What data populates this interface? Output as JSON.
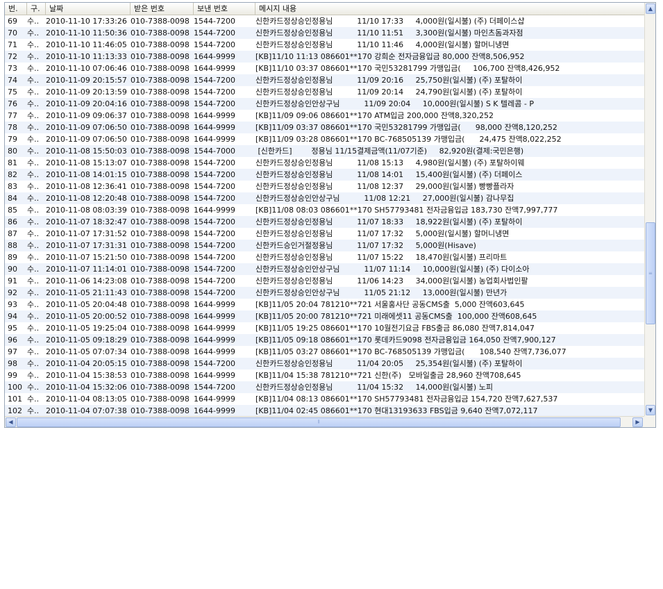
{
  "columns": [
    "번.",
    "구.",
    "날짜",
    "받은 번호",
    "보낸 번호",
    "메시지 내용"
  ],
  "rows": [
    {
      "no": "69",
      "type": "수..",
      "date": "2010-11-10 17:33:26",
      "recv": "010-7388-0098",
      "send": "1544-7200",
      "msg": "신한카드정상승인정용님          11/10 17:33     4,000원(일시불) (주) 더페이스샵"
    },
    {
      "no": "70",
      "type": "수..",
      "date": "2010-11-10 11:50:36",
      "recv": "010-7388-0098",
      "send": "1544-7200",
      "msg": "신한카드정상승인정용님          11/10 11:51     3,300원(일시불) 마인츠돔과자점"
    },
    {
      "no": "71",
      "type": "수..",
      "date": "2010-11-10 11:46:05",
      "recv": "010-7388-0098",
      "send": "1544-7200",
      "msg": "신한카드정상승인정용님          11/10 11:46     4,000원(일시불) 할머니냉면"
    },
    {
      "no": "72",
      "type": "수..",
      "date": "2010-11-10 11:13:33",
      "recv": "010-7388-0098",
      "send": "1644-9999",
      "msg": "[KB]11/10 11:13 086601**170 강희순 전자금융입금 80,000 잔액8,506,952"
    },
    {
      "no": "73",
      "type": "수..",
      "date": "2010-11-10 07:06:46",
      "recv": "010-7388-0098",
      "send": "1644-9999",
      "msg": "[KB]11/10 03:37 086601**170 국민53281799 가맹입금(     106,700 잔액8,426,952"
    },
    {
      "no": "74",
      "type": "수..",
      "date": "2010-11-09 20:15:57",
      "recv": "010-7388-0098",
      "send": "1544-7200",
      "msg": "신한카드정상승인정용님          11/09 20:16     25,750원(일시불) (주) 포탈하이"
    },
    {
      "no": "75",
      "type": "수..",
      "date": "2010-11-09 20:13:59",
      "recv": "010-7388-0098",
      "send": "1544-7200",
      "msg": "신한카드정상승인정용님          11/09 20:14     24,790원(일시불) (주) 포탈하이"
    },
    {
      "no": "76",
      "type": "수..",
      "date": "2010-11-09 20:04:16",
      "recv": "010-7388-0098",
      "send": "1544-7200",
      "msg": "신한카드정상승인안상구님          11/09 20:04     10,000원(일시불) S K 텔레콤 - P"
    },
    {
      "no": "77",
      "type": "수..",
      "date": "2010-11-09 09:06:37",
      "recv": "010-7388-0098",
      "send": "1644-9999",
      "msg": "[KB]11/09 09:06 086601**170 ATM입금 200,000 잔액8,320,252"
    },
    {
      "no": "78",
      "type": "수..",
      "date": "2010-11-09 07:06:50",
      "recv": "010-7388-0098",
      "send": "1644-9999",
      "msg": "[KB]11/09 03:37 086601**170 국민53281799 가맹입금(      98,000 잔액8,120,252"
    },
    {
      "no": "79",
      "type": "수..",
      "date": "2010-11-09 07:06:50",
      "recv": "010-7388-0098",
      "send": "1644-9999",
      "msg": "[KB]11/09 03:28 086601**170 BC-768505139 가맹입금(      24,475 잔액8,022,252"
    },
    {
      "no": "80",
      "type": "수..",
      "date": "2010-11-08 15:50:03",
      "recv": "010-7388-0098",
      "send": "1544-7000",
      "msg": " [신한카드]        정용님 11/15결제금액(11/07기준)     82,920원(결제:국민은행)"
    },
    {
      "no": "81",
      "type": "수..",
      "date": "2010-11-08 15:13:07",
      "recv": "010-7388-0098",
      "send": "1544-7200",
      "msg": "신한카드정상승인정용님          11/08 15:13     4,980원(일시불) (주) 포탈하이웨"
    },
    {
      "no": "82",
      "type": "수..",
      "date": "2010-11-08 14:01:15",
      "recv": "010-7388-0098",
      "send": "1544-7200",
      "msg": "신한카드정상승인정용님          11/08 14:01     15,400원(일시불) (주) 더페이스"
    },
    {
      "no": "83",
      "type": "수..",
      "date": "2010-11-08 12:36:41",
      "recv": "010-7388-0098",
      "send": "1544-7200",
      "msg": "신한카드정상승인정용님          11/08 12:37     29,000원(일시불) 빵빵플라자"
    },
    {
      "no": "84",
      "type": "수..",
      "date": "2010-11-08 12:20:48",
      "recv": "010-7388-0098",
      "send": "1544-7200",
      "msg": "신한카드정상승인안상구님          11/08 12:21     27,000원(일시불) 감나무집"
    },
    {
      "no": "85",
      "type": "수..",
      "date": "2010-11-08 08:03:39",
      "recv": "010-7388-0098",
      "send": "1644-9999",
      "msg": "[KB]11/08 08:03 086601**170 SH57793481 전자금융입금 183,730 잔액7,997,777"
    },
    {
      "no": "86",
      "type": "수..",
      "date": "2010-11-07 18:32:47",
      "recv": "010-7388-0098",
      "send": "1544-7200",
      "msg": "신한카드정상승인정용님          11/07 18:33     18,922원(일시불) (주) 포탈하이"
    },
    {
      "no": "87",
      "type": "수..",
      "date": "2010-11-07 17:31:52",
      "recv": "010-7388-0098",
      "send": "1544-7200",
      "msg": "신한카드정상승인정용님          11/07 17:32     5,000원(일시불) 할머니냉면"
    },
    {
      "no": "88",
      "type": "수..",
      "date": "2010-11-07 17:31:31",
      "recv": "010-7388-0098",
      "send": "1544-7200",
      "msg": "신한카드승인거절정용님          11/07 17:32     5,000원(Hisave)"
    },
    {
      "no": "89",
      "type": "수..",
      "date": "2010-11-07 15:21:50",
      "recv": "010-7388-0098",
      "send": "1544-7200",
      "msg": "신한카드정상승인정용님          11/07 15:22     18,470원(일시불) 프리마트"
    },
    {
      "no": "90",
      "type": "수..",
      "date": "2010-11-07 11:14:01",
      "recv": "010-7388-0098",
      "send": "1544-7200",
      "msg": "신한카드정상승인안상구님          11/07 11:14     10,000원(일시불) (주) 다이소아"
    },
    {
      "no": "91",
      "type": "수..",
      "date": "2010-11-06 14:23:08",
      "recv": "010-7388-0098",
      "send": "1544-7200",
      "msg": "신한카드정상승인정용님          11/06 14:23     34,000원(일시불) 농업회사법인팔"
    },
    {
      "no": "92",
      "type": "수..",
      "date": "2010-11-05 21:11:43",
      "recv": "010-7388-0098",
      "send": "1544-7200",
      "msg": "신한카드정상승인안상구님          11/05 21:12     13,000원(일시불) 만년가"
    },
    {
      "no": "93",
      "type": "수..",
      "date": "2010-11-05 20:04:48",
      "recv": "010-7388-0098",
      "send": "1644-9999",
      "msg": "[KB]11/05 20:04 781210**721 서울홍사단 공동CMS출  5,000 잔액603,645"
    },
    {
      "no": "94",
      "type": "수..",
      "date": "2010-11-05 20:00:52",
      "recv": "010-7388-0098",
      "send": "1644-9999",
      "msg": "[KB]11/05 20:00 781210**721 미래에셋11 공동CMS출  100,000 잔액608,645"
    },
    {
      "no": "95",
      "type": "수..",
      "date": "2010-11-05 19:25:04",
      "recv": "010-7388-0098",
      "send": "1644-9999",
      "msg": "[KB]11/05 19:25 086601**170 10월전기요금 FBS출금 86,080 잔액7,814,047"
    },
    {
      "no": "96",
      "type": "수..",
      "date": "2010-11-05 09:18:29",
      "recv": "010-7388-0098",
      "send": "1644-9999",
      "msg": "[KB]11/05 09:18 086601**170 롯데카드9098 전자금융입금 164,050 잔액7,900,127"
    },
    {
      "no": "97",
      "type": "수..",
      "date": "2010-11-05 07:07:34",
      "recv": "010-7388-0098",
      "send": "1644-9999",
      "msg": "[KB]11/05 03:27 086601**170 BC-768505139 가맹입금(      108,540 잔액7,736,077"
    },
    {
      "no": "98",
      "type": "수..",
      "date": "2010-11-04 20:05:15",
      "recv": "010-7388-0098",
      "send": "1544-7200",
      "msg": "신한카드정상승인정용님          11/04 20:05     25,354원(일시불) (주) 포탈하이"
    },
    {
      "no": "99",
      "type": "수..",
      "date": "2010-11-04 15:38:53",
      "recv": "010-7388-0098",
      "send": "1644-9999",
      "msg": "[KB]11/04 15:38 781210**721 신한(주)   모바일출금 28,960 잔액708,645"
    },
    {
      "no": "100",
      "type": "수..",
      "date": "2010-11-04 15:32:06",
      "recv": "010-7388-0098",
      "send": "1544-7200",
      "msg": "신한카드정상승인정용님          11/04 15:32     14,000원(일시불) 노피"
    },
    {
      "no": "101",
      "type": "수..",
      "date": "2010-11-04 08:13:05",
      "recv": "010-7388-0098",
      "send": "1644-9999",
      "msg": "[KB]11/04 08:13 086601**170 SH57793481 전자금융입금 154,720 잔액7,627,537"
    },
    {
      "no": "102",
      "type": "수..",
      "date": "2010-11-04 07:07:38",
      "recv": "010-7388-0098",
      "send": "1644-9999",
      "msg": "[KB]11/04 02:45 086601**170 현대13193633 FBS입금 9,640 잔액7,072,117"
    }
  ],
  "icons": {
    "scroll_up": "triangle-up",
    "scroll_down": "triangle-down",
    "scroll_left": "triangle-left",
    "scroll_right": "triangle-right"
  },
  "colors": {
    "row_alt": "#eef3fb",
    "header_bg": "#ebeae2",
    "scroll_thumb": "#bdd0f5"
  }
}
